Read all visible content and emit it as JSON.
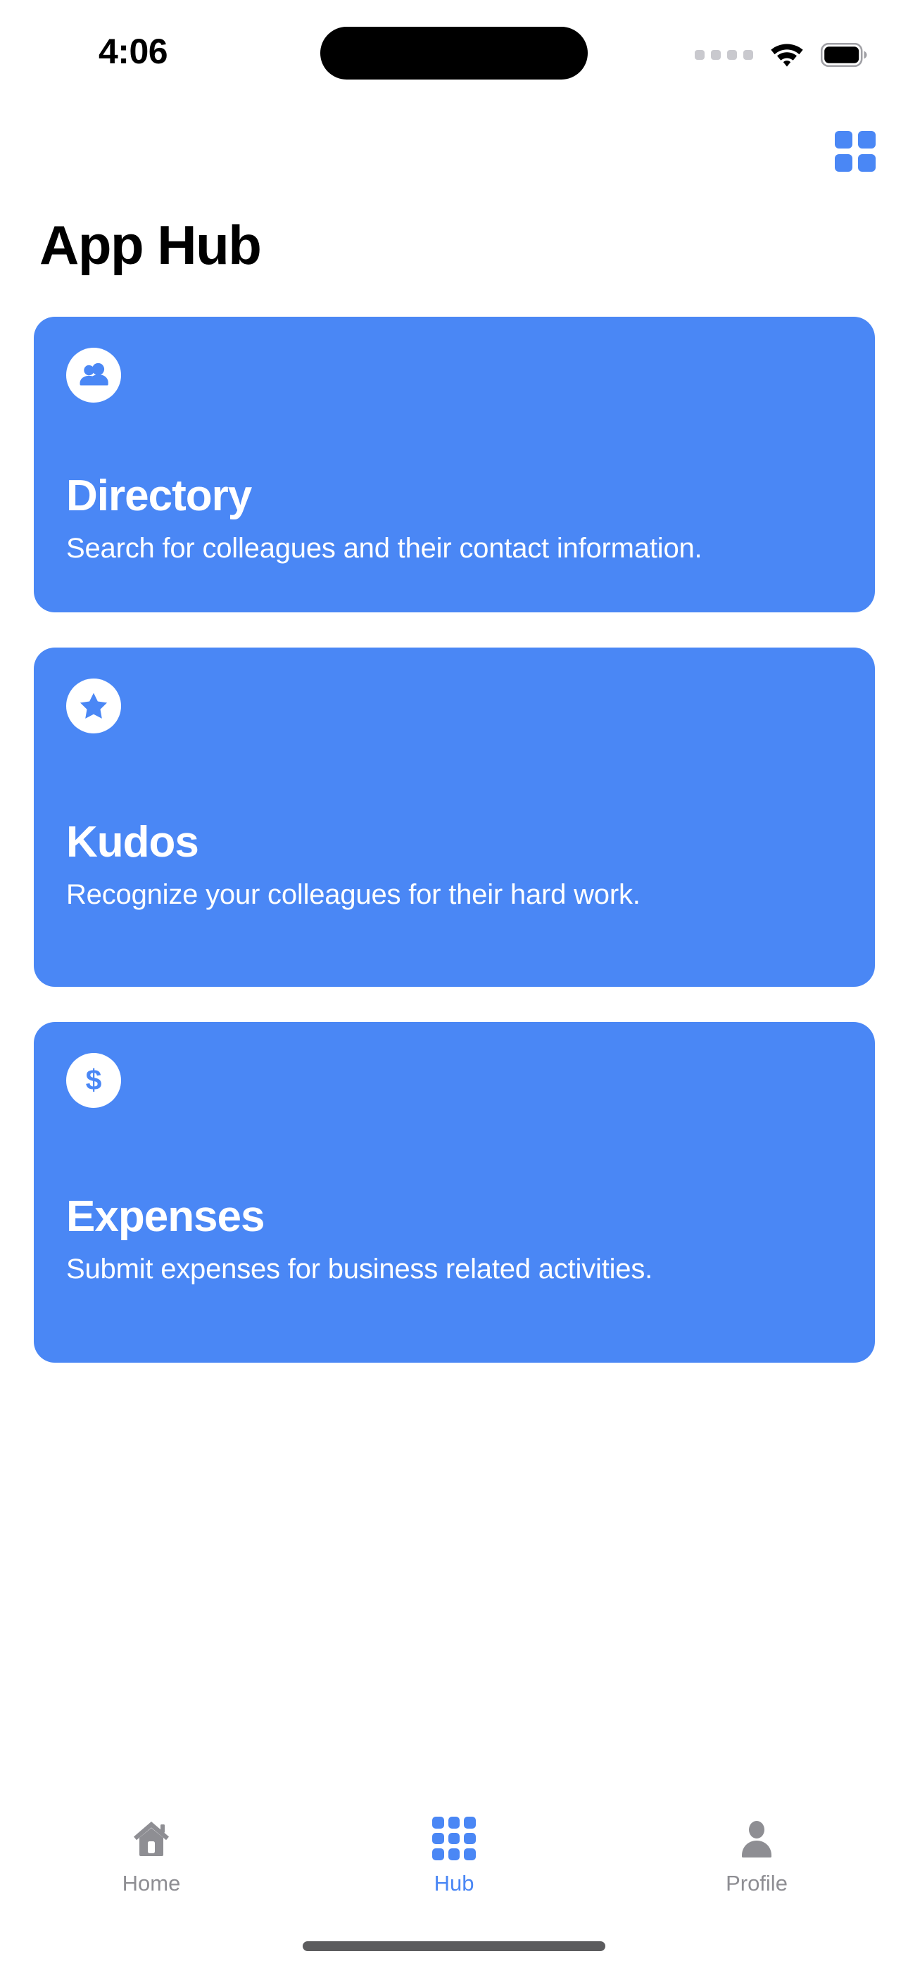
{
  "status_bar": {
    "time": "4:06",
    "signal_icon": "cellular-dots-icon",
    "wifi_icon": "wifi-icon",
    "battery_icon": "battery-icon"
  },
  "top_bar": {
    "grid_button_icon": "grid-2x2-icon"
  },
  "header": {
    "title": "App Hub"
  },
  "cards": [
    {
      "icon": "people-icon",
      "title": "Directory",
      "description": "Search for colleagues and their contact information."
    },
    {
      "icon": "star-icon",
      "title": "Kudos",
      "description": "Recognize your colleagues for their hard work."
    },
    {
      "icon": "dollar-icon",
      "title": "Expenses",
      "description": "Submit expenses for business related activities."
    }
  ],
  "tab_bar": {
    "items": [
      {
        "label": "Home",
        "icon": "home-icon",
        "active": false
      },
      {
        "label": "Hub",
        "icon": "grid-3x3-icon",
        "active": true
      },
      {
        "label": "Profile",
        "icon": "person-icon",
        "active": false
      }
    ]
  },
  "colors": {
    "accent": "#4A87F5",
    "card_background": "#4A87F5",
    "card_text": "#FFFFFF",
    "inactive_tab": "#8E8E93",
    "page_background": "#FFFFFF",
    "title_text": "#000000"
  }
}
